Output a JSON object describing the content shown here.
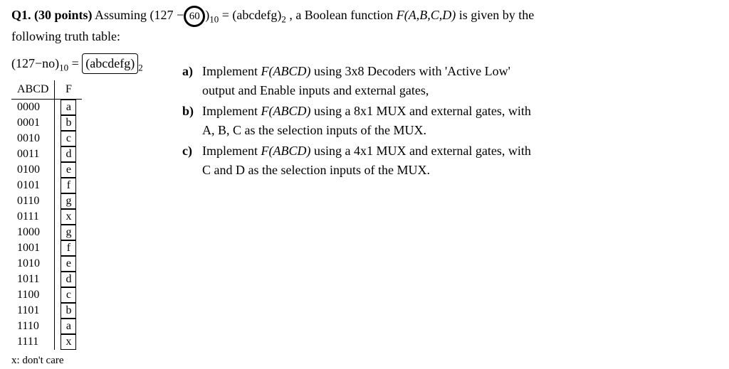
{
  "question": {
    "label": "Q1. (30 points)",
    "intro1": "Assuming ",
    "expr_lhs_a": "(127 −",
    "expr_lhs_circle": "60",
    "expr_lhs_b": ")",
    "sub10": "10",
    "eq": " = ",
    "expr_rhs": "(abcdefg)",
    "sub2": "2",
    "intro2": " , a Boolean function ",
    "func": "F(A,B,C,D)",
    "intro3": " is given by the",
    "intro4": "following truth table:"
  },
  "formula": {
    "lhs": "(127−no)",
    "sub10": "10",
    "eq": " = ",
    "rhs_boxed": "(abcdefg)",
    "sub2": "2"
  },
  "table": {
    "headers": [
      "ABCD",
      "F"
    ],
    "rows": [
      [
        "0000",
        "a"
      ],
      [
        "0001",
        "b"
      ],
      [
        "0010",
        "c"
      ],
      [
        "0011",
        "d"
      ],
      [
        "0100",
        "e"
      ],
      [
        "0101",
        "f"
      ],
      [
        "0110",
        "g"
      ],
      [
        "0111",
        "x"
      ],
      [
        "1000",
        "g"
      ],
      [
        "1001",
        "f"
      ],
      [
        "1010",
        "e"
      ],
      [
        "1011",
        "d"
      ],
      [
        "1100",
        "c"
      ],
      [
        "1101",
        "b"
      ],
      [
        "1110",
        "a"
      ],
      [
        "1111",
        "x"
      ]
    ],
    "note": "x: don't care"
  },
  "parts": {
    "a": {
      "label": "a)",
      "line1_pre": "Implement ",
      "func": "F(ABCD)",
      "line1_post": " using 3x8 Decoders with 'Active Low'",
      "line2": "output and Enable inputs and external gates,"
    },
    "b": {
      "label": "b)",
      "line1_pre": "Implement ",
      "func": "F(ABCD)",
      "line1_post": " using a 8x1 MUX and external gates, with",
      "line2": "A, B, C as the selection inputs of the MUX."
    },
    "c": {
      "label": "c)",
      "line1_pre": "Implement ",
      "func": "F(ABCD)",
      "line1_post": " using a 4x1 MUX and external gates, with",
      "line2": "C and D as the selection inputs of the MUX."
    }
  }
}
